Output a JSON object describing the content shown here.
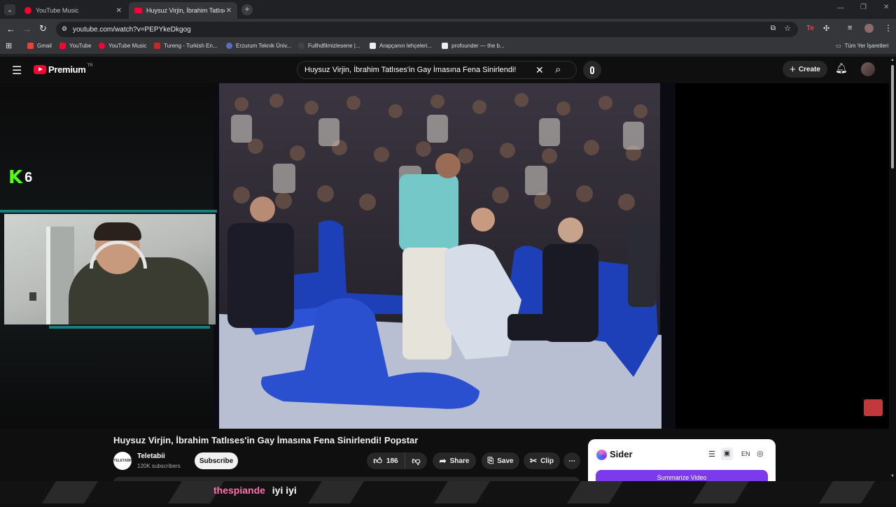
{
  "browser": {
    "tabs": [
      {
        "title": "YouTube Music",
        "active": false
      },
      {
        "title": "Huysuz Virjin, İbrahim Tatlıses'in",
        "active": true
      }
    ],
    "url": "youtube.com/watch?v=PEPYkeDkgog",
    "bookmarks": [
      "Gmail",
      "YouTube",
      "YouTube Music",
      "Tureng - Turkish En...",
      "Erzurum Teknik Üniv...",
      "Fullhdfilmizlesene |...",
      "Arapçanın lehçeleri...",
      "profounder — the b..."
    ],
    "all_bookmarks_label": "Tüm Yer İşaretleri"
  },
  "youtube": {
    "logo_text": "Premium",
    "region": "TR",
    "search_query": "Huysuz Virjin, İbrahim Tatlıses'in Gay İmasına Fena Sinirlendi!",
    "create_label": "Create"
  },
  "overlay": {
    "channel_badge": "6"
  },
  "video": {
    "title": "Huysuz Virjin, İbrahim Tatlıses'in Gay İmasına Fena Sinirlendi! Popstar",
    "channel_name": "Teletabii",
    "subscribers": "120K subscribers",
    "subscribe_label": "Subscribe",
    "likes": "186",
    "share_label": "Share",
    "save_label": "Save",
    "clip_label": "Clip"
  },
  "sider": {
    "name": "Sider",
    "lang": "EN",
    "summarize_label": "Summarize Video"
  },
  "chat": {
    "user": "thespiande",
    "message": "iyi iyi"
  },
  "colors": {
    "yt_red": "#ff0033",
    "sider_purple": "#7c3aed",
    "chat_user": "#ff6fae",
    "k_green": "#53fc18"
  }
}
